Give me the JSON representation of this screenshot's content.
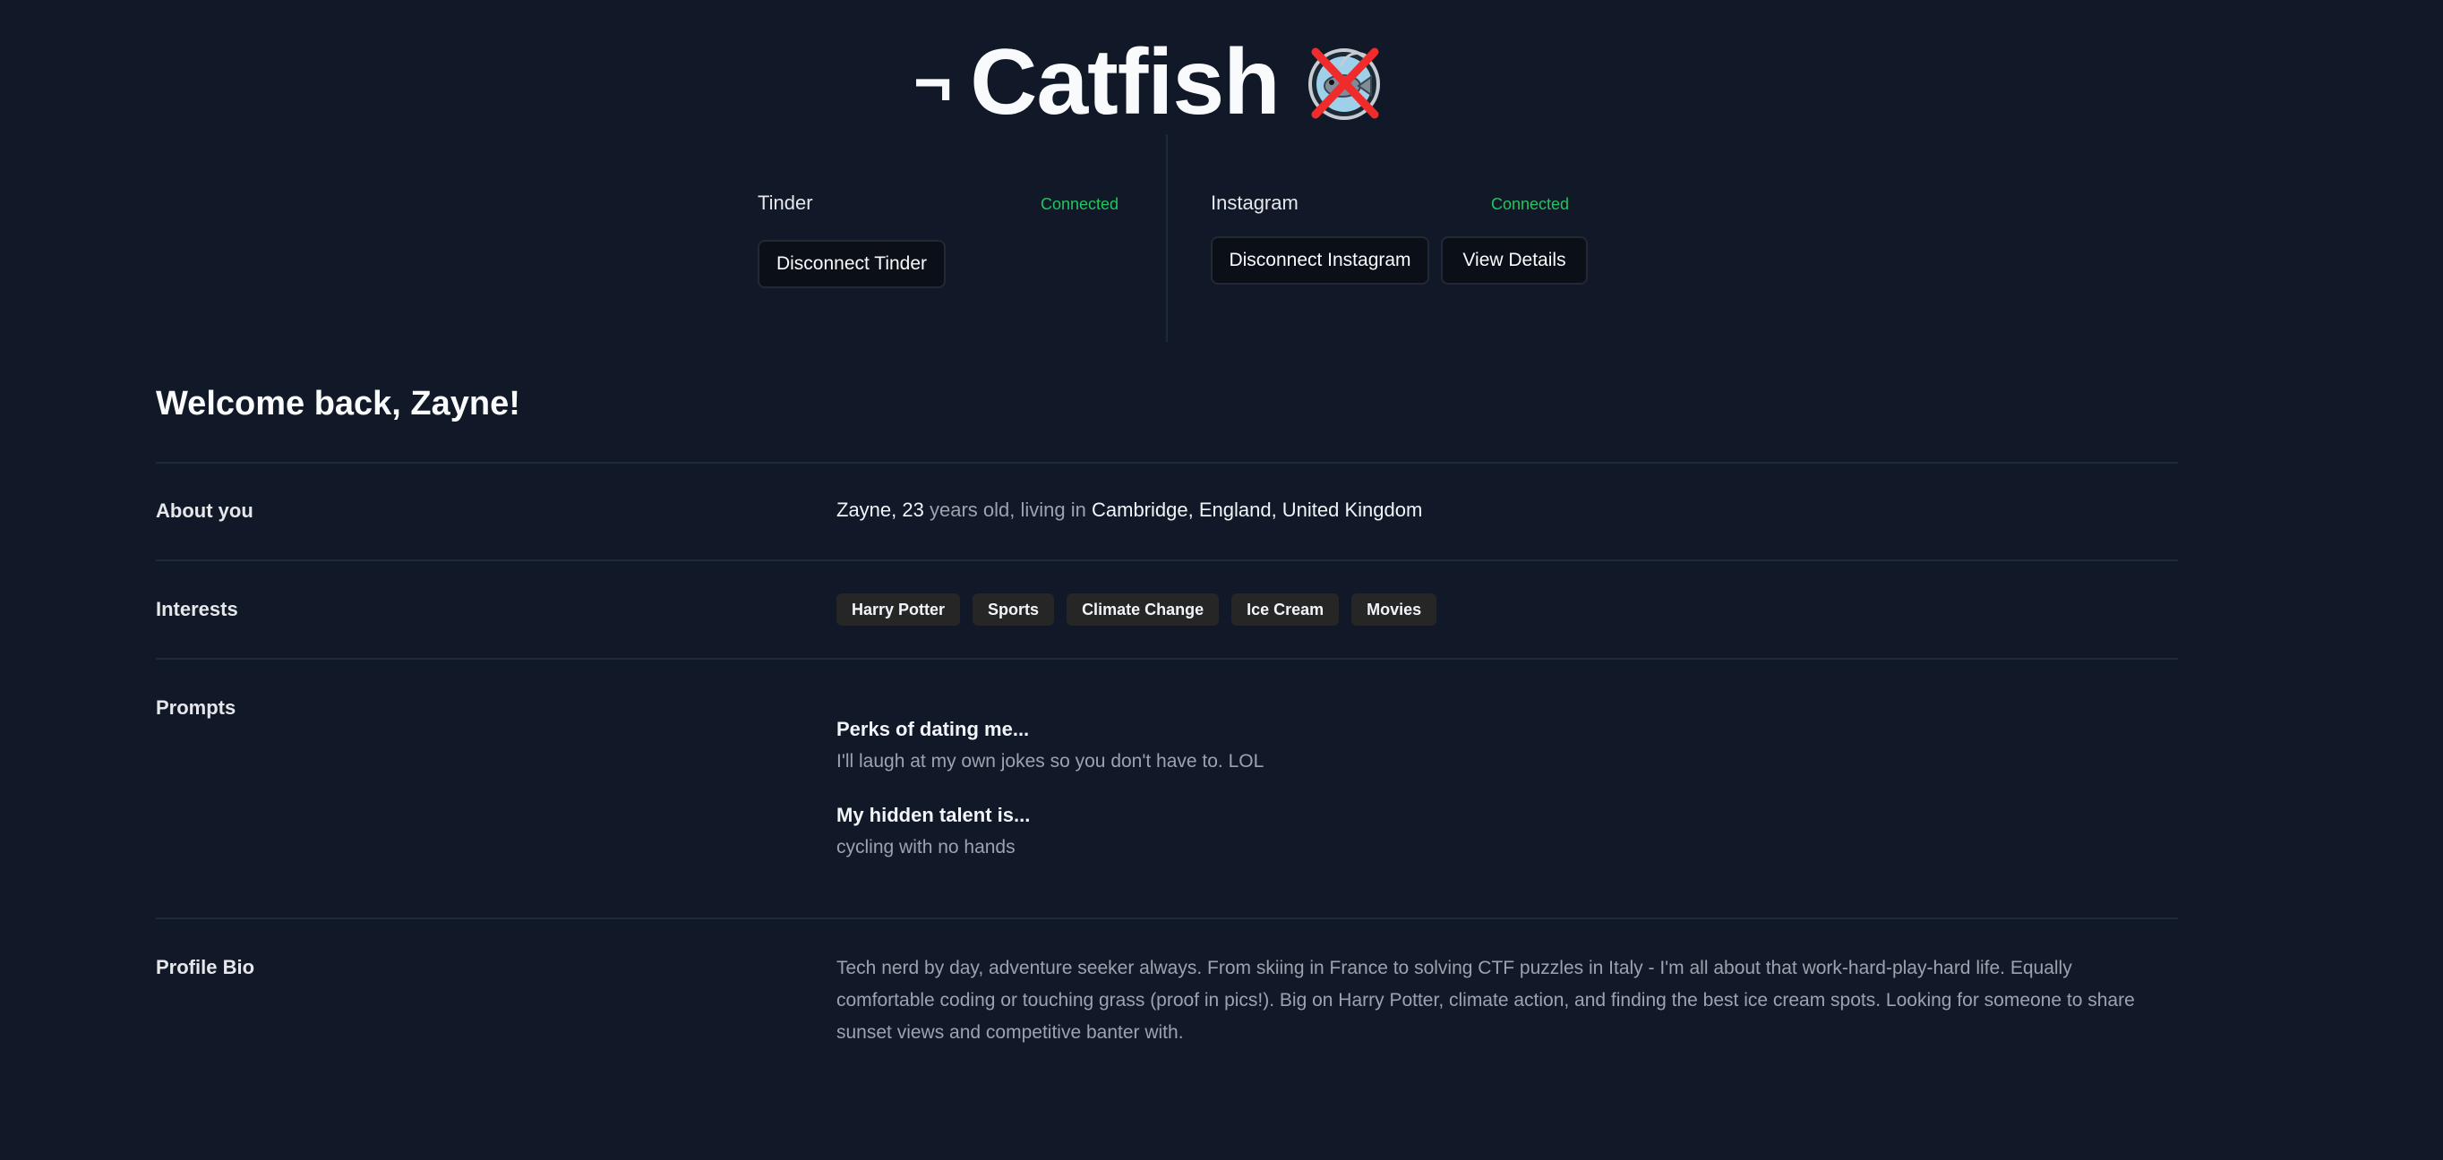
{
  "header": {
    "logo_prefix": "¬",
    "logo_text": "Catfish",
    "logo_icon": "crossed-out-fish-icon"
  },
  "services": {
    "tinder": {
      "name": "Tinder",
      "status": "Connected",
      "disconnect_label": "Disconnect Tinder"
    },
    "instagram": {
      "name": "Instagram",
      "status": "Connected",
      "disconnect_label": "Disconnect Instagram",
      "details_label": "View Details"
    }
  },
  "profile": {
    "welcome": "Welcome back, Zayne!",
    "about": {
      "label": "About you",
      "name": "Zayne",
      "age": "23",
      "age_suffix": "years old, living in",
      "location": "Cambridge, England, United Kingdom"
    },
    "interests": {
      "label": "Interests",
      "items": [
        "Harry Potter",
        "Sports",
        "Climate Change",
        "Ice Cream",
        "Movies"
      ]
    },
    "prompts": {
      "label": "Prompts",
      "items": [
        {
          "question": "Perks of dating me...",
          "answer": "I'll laugh at my own jokes so you don't have to. LOL"
        },
        {
          "question": "My hidden talent is...",
          "answer": "cycling with no hands"
        }
      ]
    },
    "bio": {
      "label": "Profile Bio",
      "text": "Tech nerd by day, adventure seeker always. From skiing in France to solving CTF puzzles in Italy - I'm all about that work-hard-play-hard life. Equally comfortable coding or touching grass (proof in pics!). Big on Harry Potter, climate action, and finding the best ice cream spots. Looking for someone to share sunset views and competitive banter with."
    }
  },
  "colors": {
    "background": "#111827",
    "status_connected": "#22c55e",
    "tag_background": "#262626",
    "logo_cross": "#ef2b2b"
  }
}
